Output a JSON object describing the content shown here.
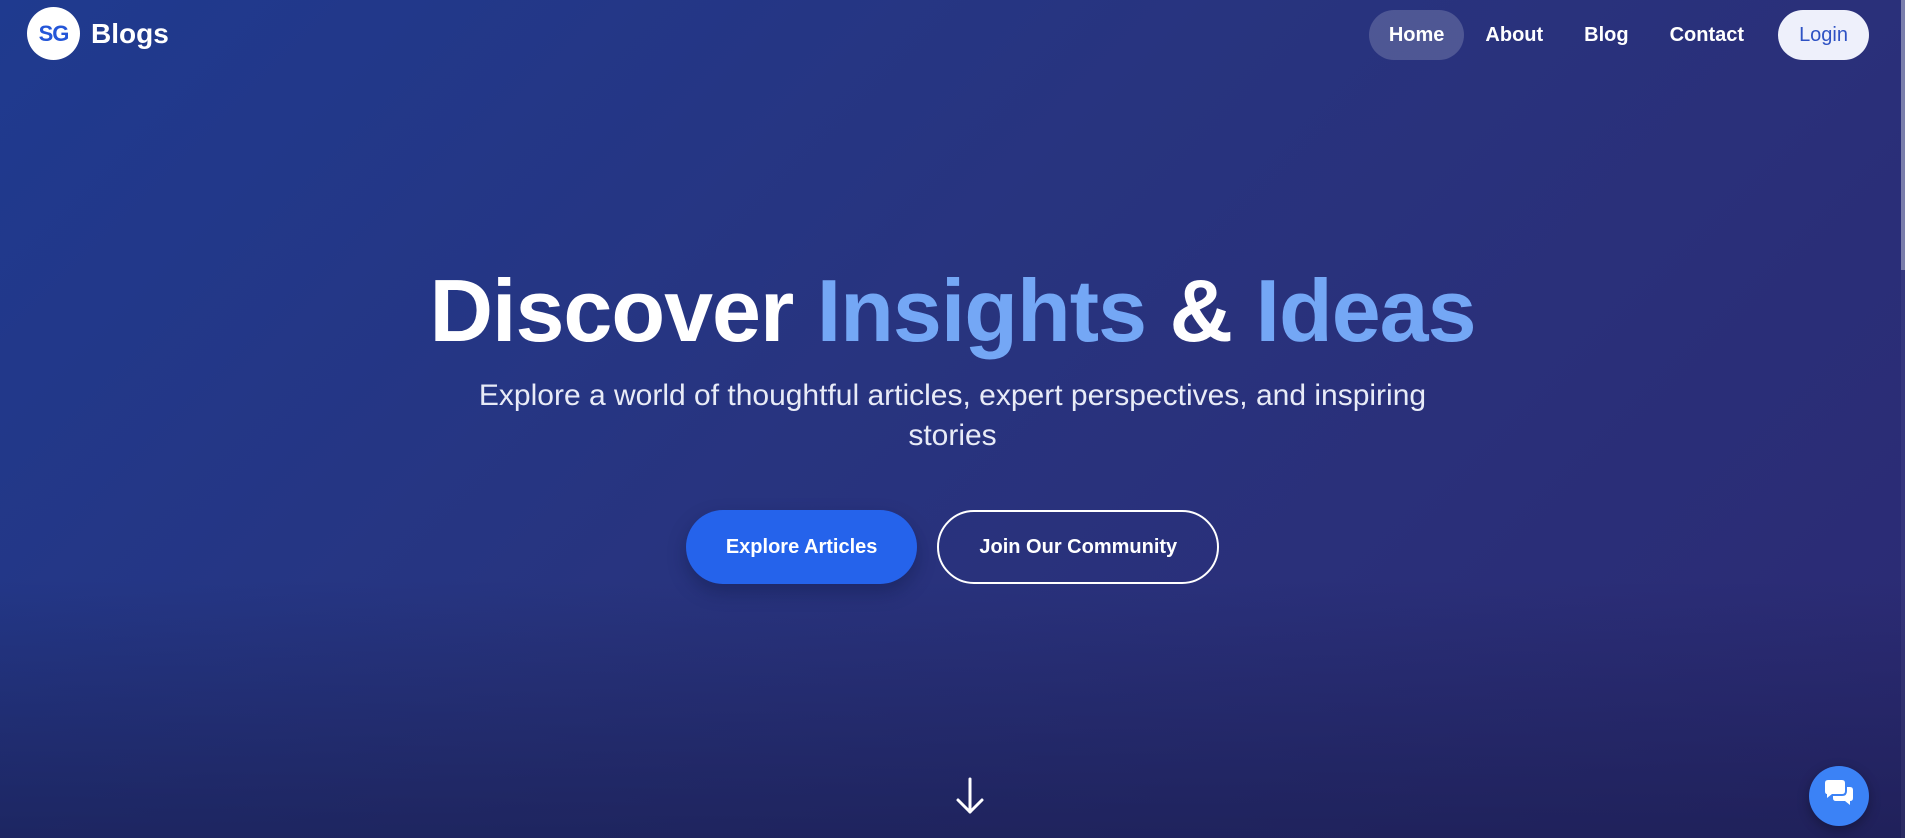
{
  "navbar": {
    "logo_text": "SG",
    "brand_name": "Blogs",
    "links": [
      {
        "label": "Home",
        "active": true
      },
      {
        "label": "About",
        "active": false
      },
      {
        "label": "Blog",
        "active": false
      },
      {
        "label": "Contact",
        "active": false
      }
    ],
    "login_label": "Login"
  },
  "hero": {
    "title_parts": {
      "p1": "Discover ",
      "p2": "Insights",
      "p3": " & ",
      "p4": "Ideas"
    },
    "subtitle": "Explore a world of thoughtful articles, expert perspectives, and inspiring stories",
    "primary_cta": "Explore Articles",
    "secondary_cta": "Join Our Community"
  },
  "icons": {
    "scroll": "arrow-down-icon",
    "chat": "chat-icon"
  },
  "colors": {
    "accent_text": "#74a7f5",
    "primary_button": "#2563eb",
    "chat_button": "#3b82f6"
  }
}
